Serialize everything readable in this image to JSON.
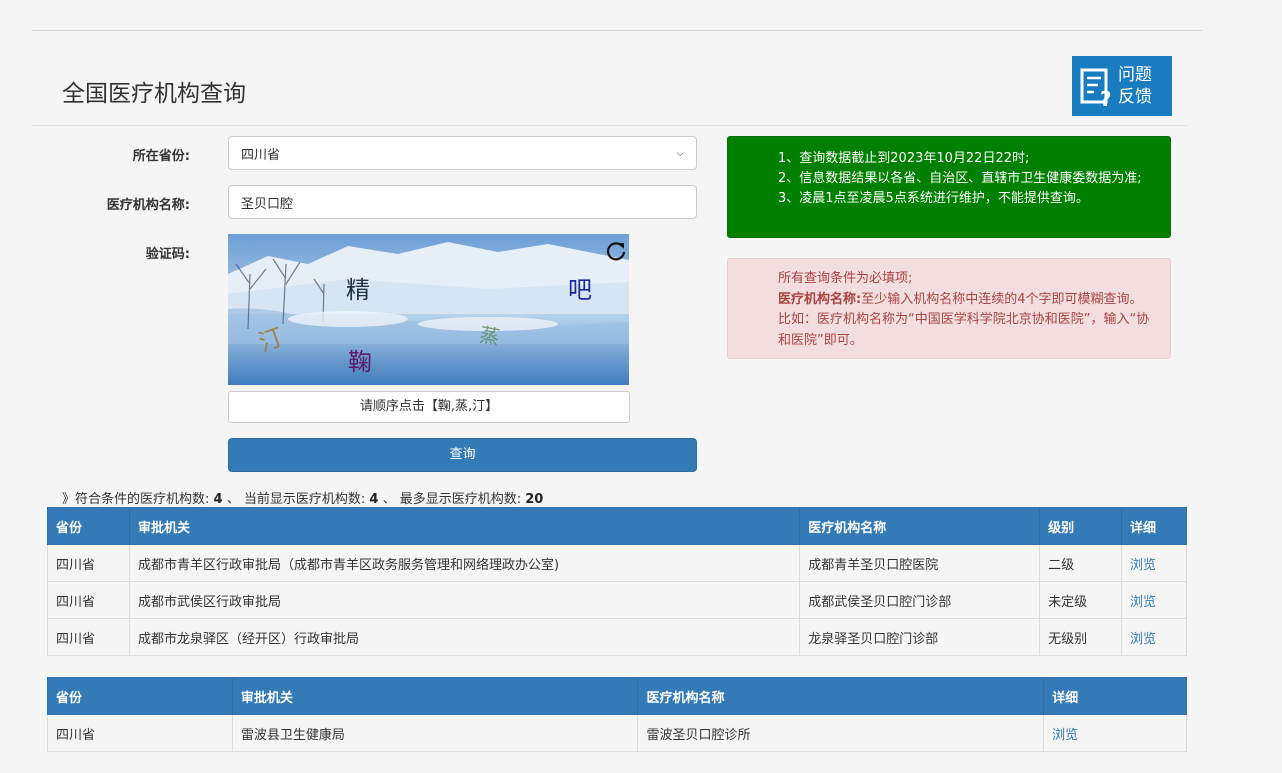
{
  "header": {
    "title": "全国医疗机构查询",
    "feedback_label_1": "问题",
    "feedback_label_2": "反馈"
  },
  "form": {
    "province_label": "所在省份:",
    "province_value": "四川省",
    "name_label": "医疗机构名称:",
    "name_value": "圣贝口腔",
    "captcha_label": "验证码:",
    "captcha_chars": [
      "精",
      "吧",
      "汀",
      "蒸",
      "鞠"
    ],
    "captcha_hint": "请顺序点击【鞠,蒸,汀】",
    "submit_label": "查询"
  },
  "notice": {
    "green": [
      "1、查询数据截止到2023年10月22日22时;",
      "2、信息数据结果以各省、自治区、直辖市卫生健康委数据为准;",
      "3、凌晨1点至凌晨5点系统进行维护，不能提供查询。"
    ],
    "red_line1": "所有查询条件为必填项;",
    "red_bold": "医疗机构名称:",
    "red_rest": "至少输入机构名称中连续的4个字即可模糊查询。比如：医疗机构名称为“中国医学科学院北京协和医院”，输入“协和医院”即可。"
  },
  "summary": {
    "prefix": "》符合条件的医疗机构数:",
    "match_count": "4",
    "sep1": "、 当前显示医疗机构数:",
    "shown_count": "4",
    "sep2": "、 最多显示医疗机构数:",
    "max_count": "20"
  },
  "table1": {
    "headers": [
      "省份",
      "审批机关",
      "医疗机构名称",
      "级别",
      "详细"
    ],
    "rows": [
      [
        "四川省",
        "成都市青羊区行政审批局（成都市青羊区政务服务管理和网络理政办公室)",
        "成都青羊圣贝口腔医院",
        "二级",
        "浏览"
      ],
      [
        "四川省",
        "成都市武侯区行政审批局",
        "成都武侯圣贝口腔门诊部",
        "未定级",
        "浏览"
      ],
      [
        "四川省",
        "成都市龙泉驿区（经开区）行政审批局",
        "龙泉驿圣贝口腔门诊部",
        "无级别",
        "浏览"
      ]
    ]
  },
  "table2": {
    "headers": [
      "省份",
      "审批机关",
      "医疗机构名称",
      "详细"
    ],
    "rows": [
      [
        "四川省",
        "雷波县卫生健康局",
        "雷波圣贝口腔诊所",
        "浏览"
      ]
    ]
  },
  "colors": {
    "primary": "#337ab7",
    "notice_green": "#008000",
    "notice_red_bg": "#f2dede",
    "notice_red_text": "#a94442"
  }
}
